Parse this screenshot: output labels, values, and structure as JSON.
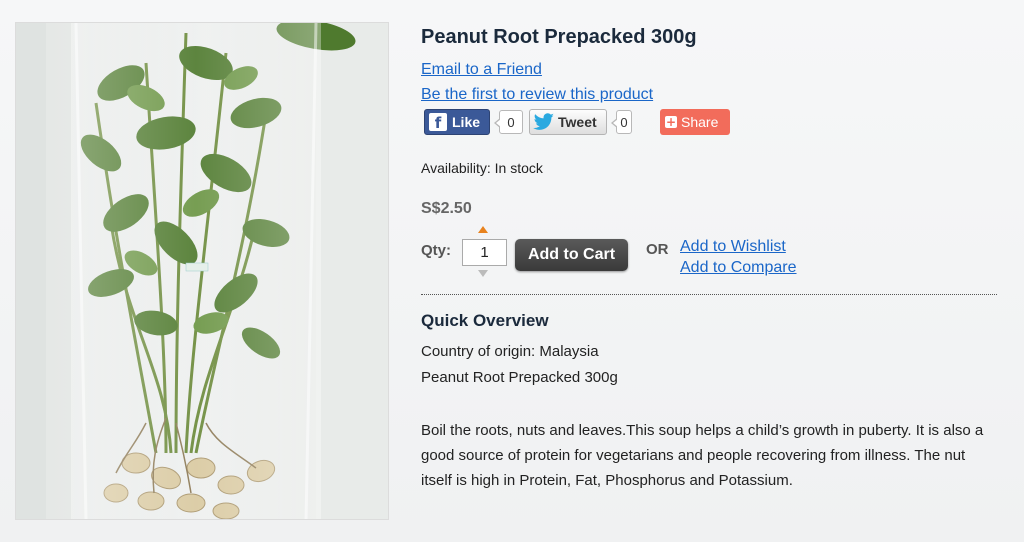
{
  "product": {
    "title": "Peanut Root Prepacked 300g",
    "email_friend": "Email to a Friend",
    "first_review": "Be the first to review this product",
    "availability": "Availability: In stock",
    "price": "S$2.50",
    "qty_label": "Qty:",
    "qty_value": "1",
    "add_to_cart": "Add to Cart",
    "or_label": "OR",
    "add_to_wishlist": "Add to Wishlist",
    "add_to_compare": "Add to Compare"
  },
  "social": {
    "fb_label": "Like",
    "fb_logo": "f",
    "fb_count": "0",
    "tweet_label": "Tweet",
    "tweet_count": "0",
    "share_label": "Share",
    "share_plus": "+",
    "icons": [
      "facebook-icon",
      "twitter-bird-icon",
      "share-plus-icon"
    ],
    "colors": {
      "facebook": "#3b5998",
      "share": "#f26c5b"
    }
  },
  "overview": {
    "title": "Quick Overview",
    "origin": "Country of origin: Malaysia",
    "name": "Peanut Root Prepacked 300g",
    "description": "Boil the roots, nuts and leaves.This soup helps a child’s growth in puberty. It is also a good source of protein for vegetarians and people recovering from illness. The nut itself is high in Protein, Fat, Phosphorus and Potassium."
  },
  "colors": {
    "link": "#1a66c8",
    "title": "#1b2a3c",
    "qty_up_arrow": "#e8821e"
  }
}
